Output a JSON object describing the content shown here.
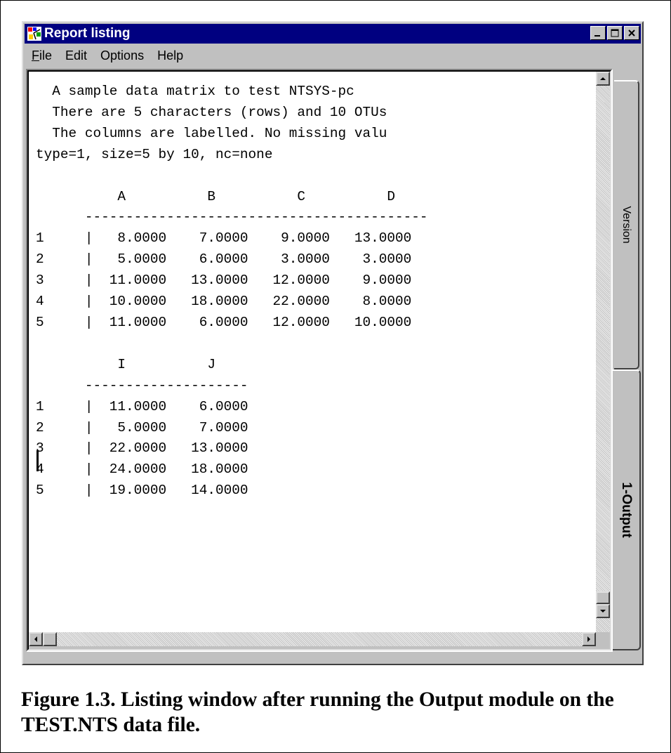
{
  "window": {
    "title": "Report listing",
    "buttons": [
      "minimize-button",
      "maximize-button",
      "close-button"
    ]
  },
  "menu": {
    "file": {
      "underlined": "F",
      "rest": "ile"
    },
    "edit": "Edit",
    "options": "Options",
    "help": "Help"
  },
  "listing": {
    "text": "  A sample data matrix to test NTSYS-pc\n  There are 5 characters (rows) and 10 OTUs\n  The columns are labelled. No missing valu\ntype=1, size=5 by 10, nc=none\n\n          A          B          C          D\n      ------------------------------------------\n1     |   8.0000    7.0000    9.0000   13.0000\n2     |   5.0000    6.0000    3.0000    3.0000\n3     |  11.0000   13.0000   12.0000    9.0000\n4     |  10.0000   18.0000   22.0000    8.0000\n5     |  11.0000    6.0000   12.0000   10.0000\n\n          I          J\n      --------------------\n1     |  11.0000    6.0000\n2     |   5.0000    7.0000\n3     |  22.0000   13.0000\n4     |  24.0000   18.0000\n5     |  19.0000   14.0000"
  },
  "tabs": {
    "version": "Version",
    "output": "1-Output"
  },
  "caption": "Figure 1.3. Listing window after running the Output module on the TEST.NTS data file."
}
